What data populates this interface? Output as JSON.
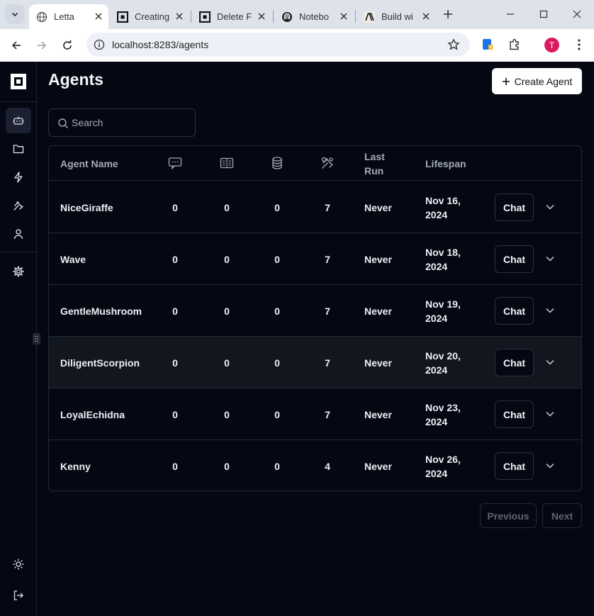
{
  "browser": {
    "tabs": [
      {
        "title": "Letta",
        "active": true
      },
      {
        "title": "Creating",
        "active": false
      },
      {
        "title": "Delete F",
        "active": false
      },
      {
        "title": "Notebo",
        "active": false
      },
      {
        "title": "Build wi",
        "active": false
      }
    ],
    "url": "localhost:8283/agents",
    "profile_initial": "T"
  },
  "page": {
    "title": "Agents",
    "create_button": "Create Agent",
    "search_placeholder": "Search"
  },
  "table": {
    "headers": {
      "name": "Agent Name",
      "messages_icon": "message-icon",
      "memory_icon": "book-icon",
      "sources_icon": "database-icon",
      "tools_icon": "tools-icon",
      "last_run": "Last Run",
      "lifespan": "Lifespan"
    },
    "rows": [
      {
        "name": "NiceGiraffe",
        "c1": "0",
        "c2": "0",
        "c3": "0",
        "c4": "7",
        "last_run": "Never",
        "lifespan": "Nov 16, 2024",
        "chat": "Chat"
      },
      {
        "name": "Wave",
        "c1": "0",
        "c2": "0",
        "c3": "0",
        "c4": "7",
        "last_run": "Never",
        "lifespan": "Nov 18, 2024",
        "chat": "Chat"
      },
      {
        "name": "GentleMushroom",
        "c1": "0",
        "c2": "0",
        "c3": "0",
        "c4": "7",
        "last_run": "Never",
        "lifespan": "Nov 19, 2024",
        "chat": "Chat"
      },
      {
        "name": "DiligentScorpion",
        "c1": "0",
        "c2": "0",
        "c3": "0",
        "c4": "7",
        "last_run": "Never",
        "lifespan": "Nov 20, 2024",
        "chat": "Chat"
      },
      {
        "name": "LoyalEchidna",
        "c1": "0",
        "c2": "0",
        "c3": "0",
        "c4": "7",
        "last_run": "Never",
        "lifespan": "Nov 23, 2024",
        "chat": "Chat"
      },
      {
        "name": "Kenny",
        "c1": "0",
        "c2": "0",
        "c3": "0",
        "c4": "4",
        "last_run": "Never",
        "lifespan": "Nov 26, 2024",
        "chat": "Chat"
      }
    ]
  },
  "pagination": {
    "previous": "Previous",
    "next": "Next"
  },
  "sidebar_icons": [
    "bot-icon",
    "folder-icon",
    "zap-icon",
    "tools-icon",
    "user-icon",
    "settings-icon",
    "sun-icon",
    "logout-icon"
  ]
}
